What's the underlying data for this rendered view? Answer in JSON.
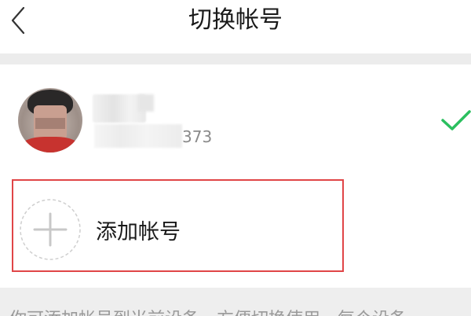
{
  "header": {
    "title": "切换帐号",
    "back_icon": "chevron-left-icon"
  },
  "account": {
    "id_suffix": "373",
    "selected_icon": "check-icon",
    "check_color": "#2bbf5f"
  },
  "add_account": {
    "label": "添加帐号",
    "icon": "plus-icon"
  },
  "footer": {
    "note": "你可添加帐号到当前设备，方便切换使用，每个设备"
  },
  "colors": {
    "highlight_border": "#e04547",
    "divider_bg": "#ececec"
  }
}
